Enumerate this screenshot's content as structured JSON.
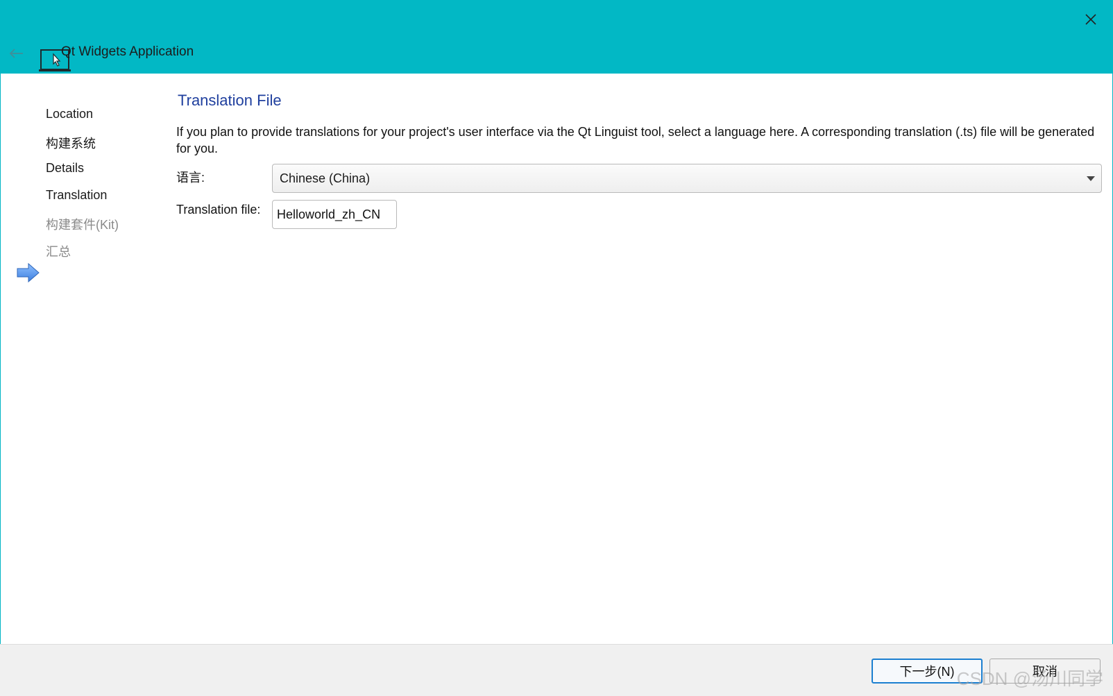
{
  "window": {
    "title": "Qt Widgets Application",
    "accent_color": "#02b8c5"
  },
  "steps": [
    {
      "label": "Location",
      "state": "done"
    },
    {
      "label": "构建系统",
      "state": "done"
    },
    {
      "label": "Details",
      "state": "done"
    },
    {
      "label": "Translation",
      "state": "current"
    },
    {
      "label": "构建套件(Kit)",
      "state": "future"
    },
    {
      "label": "汇总",
      "state": "future"
    }
  ],
  "page": {
    "title": "Translation File",
    "description": "If you plan to provide translations for your project's user interface via the Qt Linguist tool, select a language here. A corresponding translation (.ts) file will be generated for you.",
    "language_label": "语言:",
    "language_value": "Chinese (China)",
    "file_label": "Translation file:",
    "file_value": "Helloworld_zh_CN"
  },
  "footer": {
    "next_label": "下一步(N)",
    "cancel_label": "取消"
  },
  "watermark": "CSDN @汤川同学",
  "icons": {
    "close": "close-icon",
    "back": "back-arrow-icon",
    "app": "laptop-cursor-icon",
    "current_step": "right-arrow-icon",
    "dropdown": "chevron-down-icon"
  }
}
